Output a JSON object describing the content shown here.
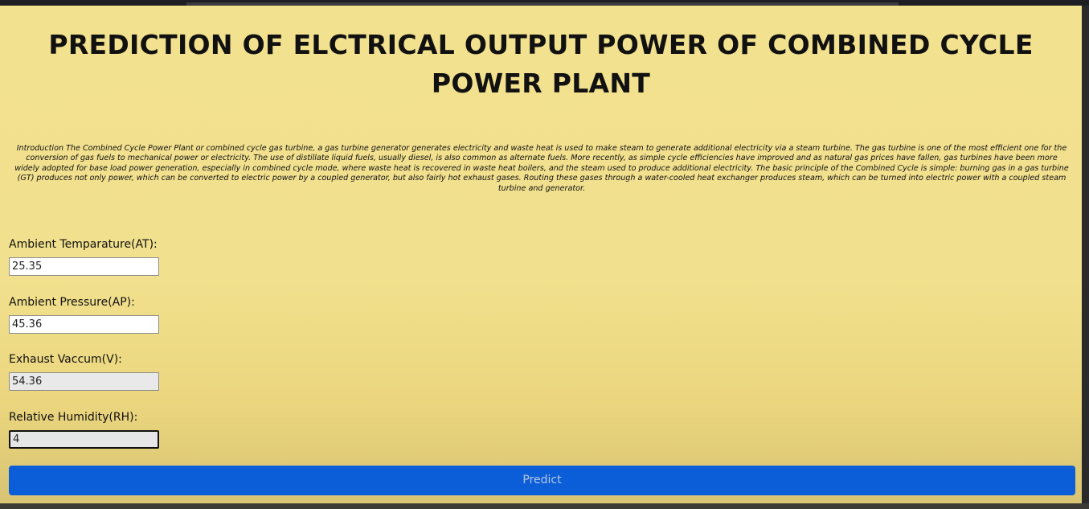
{
  "page": {
    "title": "PREDICTION OF ELCTRICAL OUTPUT POWER OF COMBINED CYCLE POWER PLANT",
    "intro": "Introduction The Combined Cycle Power Plant or combined cycle gas turbine, a gas turbine generator generates electricity and waste heat is used to make steam to generate additional electricity via a steam turbine. The gas turbine is one of the most efficient one for the conversion of gas fuels to mechanical power or electricity. The use of distillate liquid fuels, usually diesel, is also common as alternate fuels. More recently, as simple cycle efficiencies have improved and as natural gas prices have fallen, gas turbines have been more widely adopted for base load power generation, especially in combined cycle mode, where waste heat is recovered in waste heat boilers, and the steam used to produce additional electricity. The basic principle of the Combined Cycle is simple: burning gas in a gas turbine (GT) produces not only power, which can be converted to electric power by a coupled generator, but also fairly hot exhaust gases. Routing these gases through a water-cooled heat exchanger produces steam, which can be turned into electric power with a coupled steam turbine and generator."
  },
  "form": {
    "fields": [
      {
        "label": "Ambient Temparature(AT):",
        "value": "25.35"
      },
      {
        "label": "Ambient Pressure(AP):",
        "value": "45.36"
      },
      {
        "label": "Exhaust Vaccum(V):",
        "value": "54.36"
      },
      {
        "label": "Relative Humidity(RH):",
        "value": "4"
      }
    ],
    "submit_label": "Predict"
  },
  "colors": {
    "page_background": "#f2e18f",
    "button_background": "#0b5ed7",
    "button_text": "#b8c7e6"
  }
}
